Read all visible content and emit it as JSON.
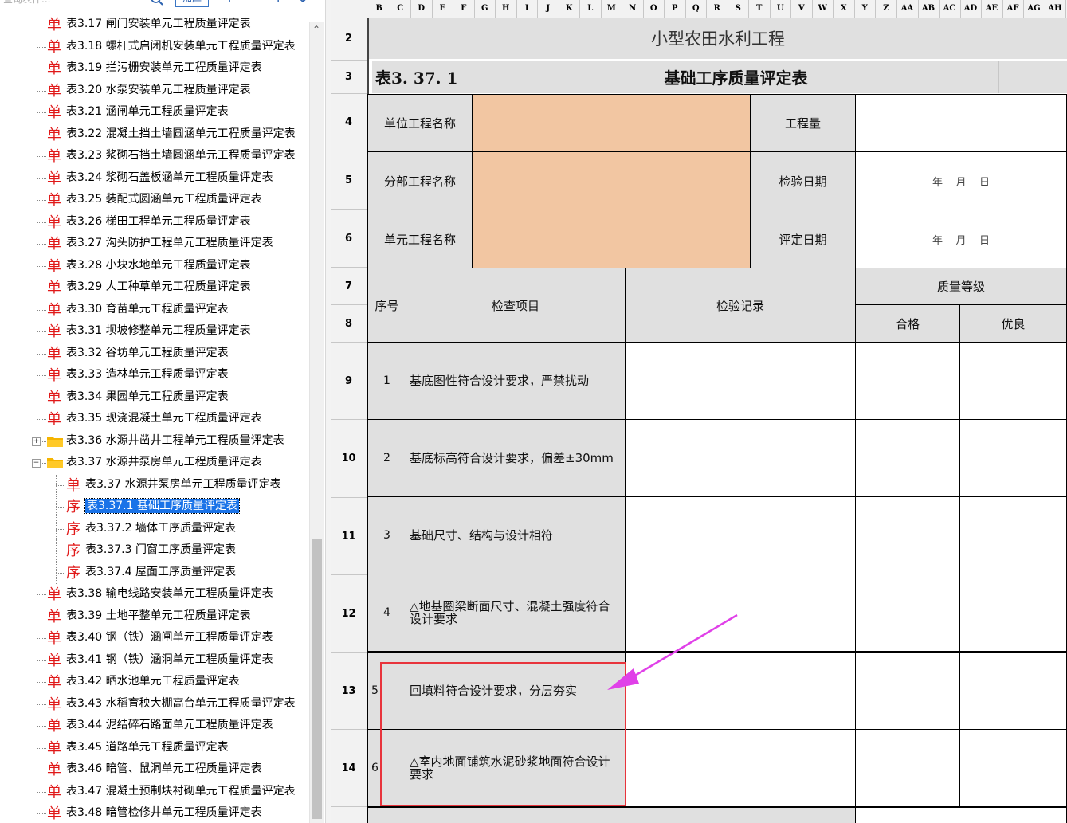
{
  "toolbar": {
    "search_placeholder": "查询表件...",
    "add_library_label": "加库",
    "add_icon": "+",
    "remove_icon": "−",
    "up_icon": "↑",
    "down_icon": "↓"
  },
  "tree": {
    "items": [
      {
        "glyph": "单",
        "label": "表3.17 闸门安装单元工程质量评定表"
      },
      {
        "glyph": "单",
        "label": "表3.18 螺杆式启闭机安装单元工程质量评定表"
      },
      {
        "glyph": "单",
        "label": "表3.19 拦污栅安装单元工程质量评定表"
      },
      {
        "glyph": "单",
        "label": "表3.20 水泵安装单元工程质量评定表"
      },
      {
        "glyph": "单",
        "label": "表3.21 涵闸单元工程质量评定表"
      },
      {
        "glyph": "单",
        "label": "表3.22 混凝土挡土墙圆涵单元工程质量评定表"
      },
      {
        "glyph": "单",
        "label": "表3.23 浆砌石挡土墙圆涵单元工程质量评定表"
      },
      {
        "glyph": "单",
        "label": "表3.24 浆砌石盖板涵单元工程质量评定表"
      },
      {
        "glyph": "单",
        "label": "表3.25 装配式圆涵单元工程质量评定表"
      },
      {
        "glyph": "单",
        "label": "表3.26 梯田工程单元工程质量评定表"
      },
      {
        "glyph": "单",
        "label": "表3.27 沟头防护工程单元工程质量评定表"
      },
      {
        "glyph": "单",
        "label": "表3.28 小块水地单元工程质量评定表"
      },
      {
        "glyph": "单",
        "label": "表3.29 人工种草单元工程质量评定表"
      },
      {
        "glyph": "单",
        "label": "表3.30 育苗单元工程质量评定表"
      },
      {
        "glyph": "单",
        "label": "表3.31 坝坡修整单元工程质量评定表"
      },
      {
        "glyph": "单",
        "label": "表3.32 谷坊单元工程质量评定表"
      },
      {
        "glyph": "单",
        "label": "表3.33 造林单元工程质量评定表"
      },
      {
        "glyph": "单",
        "label": "表3.34 果园单元工程质量评定表"
      },
      {
        "glyph": "单",
        "label": "表3.35 现浇混凝土单元工程质量评定表"
      },
      {
        "glyph": "folder",
        "label": "表3.36 水源井凿井工程单元工程质量评定表",
        "expander": "+"
      },
      {
        "glyph": "folder",
        "label": "表3.37 水源井泵房单元工程质量评定表",
        "expander": "−"
      },
      {
        "glyph": "单",
        "label": "表3.37 水源井泵房单元工程质量评定表",
        "child": true
      },
      {
        "glyph": "序",
        "label": "表3.37.1 基础工序质量评定表",
        "child": true,
        "selected": true
      },
      {
        "glyph": "序",
        "label": "表3.37.2 墙体工序质量评定表",
        "child": true
      },
      {
        "glyph": "序",
        "label": "表3.37.3 门窗工序质量评定表",
        "child": true
      },
      {
        "glyph": "序",
        "label": "表3.37.4 屋面工序质量评定表",
        "child": true
      },
      {
        "glyph": "单",
        "label": "表3.38 输电线路安装单元工程质量评定表"
      },
      {
        "glyph": "单",
        "label": "表3.39 土地平整单元工程质量评定表"
      },
      {
        "glyph": "单",
        "label": "表3.40 钢（铁）涵闸单元工程质量评定表"
      },
      {
        "glyph": "单",
        "label": "表3.41 钢（铁）涵洞单元工程质量评定表"
      },
      {
        "glyph": "单",
        "label": "表3.42 晒水池单元工程质量评定表"
      },
      {
        "glyph": "单",
        "label": "表3.43 水稻育秧大棚高台单元工程质量评定表"
      },
      {
        "glyph": "单",
        "label": "表3.44 泥结碎石路面单元工程质量评定表"
      },
      {
        "glyph": "单",
        "label": "表3.45 道路单元工程质量评定表"
      },
      {
        "glyph": "单",
        "label": "表3.46 暗管、鼠洞单元工程质量评定表"
      },
      {
        "glyph": "单",
        "label": "表3.47 混凝土预制块衬砌单元工程质量评定表"
      },
      {
        "glyph": "单",
        "label": "表3.48 暗管检修井单元工程质量评定表"
      }
    ]
  },
  "columns": [
    "B",
    "C",
    "D",
    "E",
    "F",
    "G",
    "H",
    "I",
    "J",
    "K",
    "L",
    "M",
    "N",
    "O",
    "P",
    "Q",
    "R",
    "S",
    "T",
    "U",
    "V",
    "W",
    "X",
    "Y",
    "Z",
    "AA",
    "AB",
    "AC",
    "AD",
    "AE",
    "AF",
    "AG",
    "AH"
  ],
  "rows": [
    "2",
    "3",
    "4",
    "5",
    "6",
    "7",
    "8",
    "9",
    "10",
    "11",
    "12",
    "13",
    "14"
  ],
  "form": {
    "project_title": "小型农田水利工程",
    "table_no": "表3. 37. 1",
    "table_title": "基础工序质量评定表",
    "unit_project_label": "单位工程名称",
    "quantity_label": "工程量",
    "sub_project_label": "分部工程名称",
    "inspect_date_label": "检验日期",
    "element_project_label": "单元工程名称",
    "assess_date_label": "评定日期",
    "date_placeholder": "年    月    日",
    "seq_header": "序号",
    "item_header": "检查项目",
    "record_header": "检验记录",
    "grade_header": "质量等级",
    "pass_header": "合格",
    "excellent_header": "优良",
    "items": [
      {
        "no": "1",
        "text": "基底图性符合设计要求，严禁扰动"
      },
      {
        "no": "2",
        "text": "基底标高符合设计要求，偏差±30mm"
      },
      {
        "no": "3",
        "text": "基础尺寸、结构与设计相符"
      },
      {
        "no": "4",
        "text": "△地基圈梁断面尺寸、混凝土强度符合设计要求"
      },
      {
        "no": "5",
        "text": "回填料符合设计要求，分层夯实"
      },
      {
        "no": "6",
        "text": "△室内地面铺筑水泥砂浆地面符合设计要求"
      }
    ]
  },
  "colors": {
    "highlight_box": "#e8343c",
    "arrow": "#e040e8",
    "peach_fill": "#f2c6a2",
    "gray_fill": "#e0e0e0",
    "selection": "#1a73e8"
  }
}
